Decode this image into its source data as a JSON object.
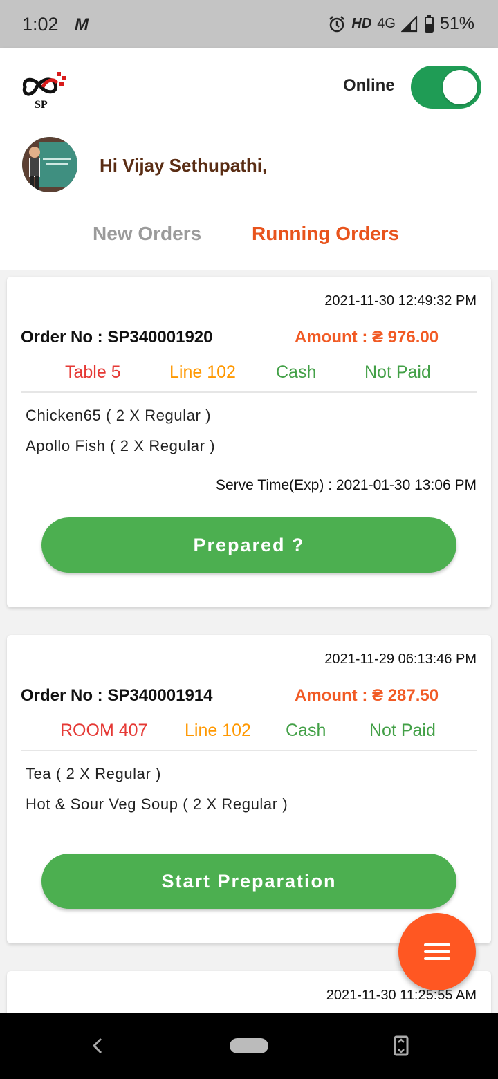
{
  "status_bar": {
    "time": "1:02",
    "carrier_icon": "M",
    "hd": "HD",
    "network": "4G",
    "battery": "51%"
  },
  "header": {
    "logo_text": "SP",
    "online_label": "Online",
    "online_toggle_on": true
  },
  "greeting": "Hi Vijay Sethupathi,",
  "tabs": {
    "new_orders": "New Orders",
    "running_orders": "Running Orders",
    "active": "running_orders"
  },
  "orders": [
    {
      "timestamp": "2021-11-30 12:49:32 PM",
      "order_no": "Order No : SP340001920",
      "amount": "Amount : ₴ 976.00",
      "location": "Table 5",
      "line": "Line 102",
      "payment_method": "Cash",
      "payment_status": "Not Paid",
      "items": [
        "Chicken65  ( 2 X Regular )",
        "Apollo Fish  ( 2 X Regular )"
      ],
      "serve_time": "Serve Time(Exp) : 2021-01-30 13:06 PM",
      "action": "Prepared ?"
    },
    {
      "timestamp": "2021-11-29 06:13:46 PM",
      "order_no": "Order No : SP340001914",
      "amount": "Amount : ₴ 287.50",
      "location": "ROOM 407",
      "line": "Line 102",
      "payment_method": "Cash",
      "payment_status": "Not Paid",
      "items": [
        "Tea  ( 2 X Regular )",
        "Hot & Sour Veg Soup  ( 2 X Regular )"
      ],
      "serve_time": "",
      "action": "Start Preparation"
    },
    {
      "timestamp": "2021-11-30 11:25:55 AM"
    }
  ],
  "colors": {
    "accent_orange": "#e8541d",
    "amount": "#f15a24",
    "location": "#e53935",
    "line": "#ff9800",
    "paid_status": "#43a047",
    "button_green": "#4caf50",
    "toggle_green": "#1f9c55",
    "fab": "#ff5722"
  },
  "icons": {
    "fab": "menu-icon",
    "nav_back": "back-icon",
    "nav_home": "home-icon",
    "nav_rotate": "rotate-icon"
  }
}
